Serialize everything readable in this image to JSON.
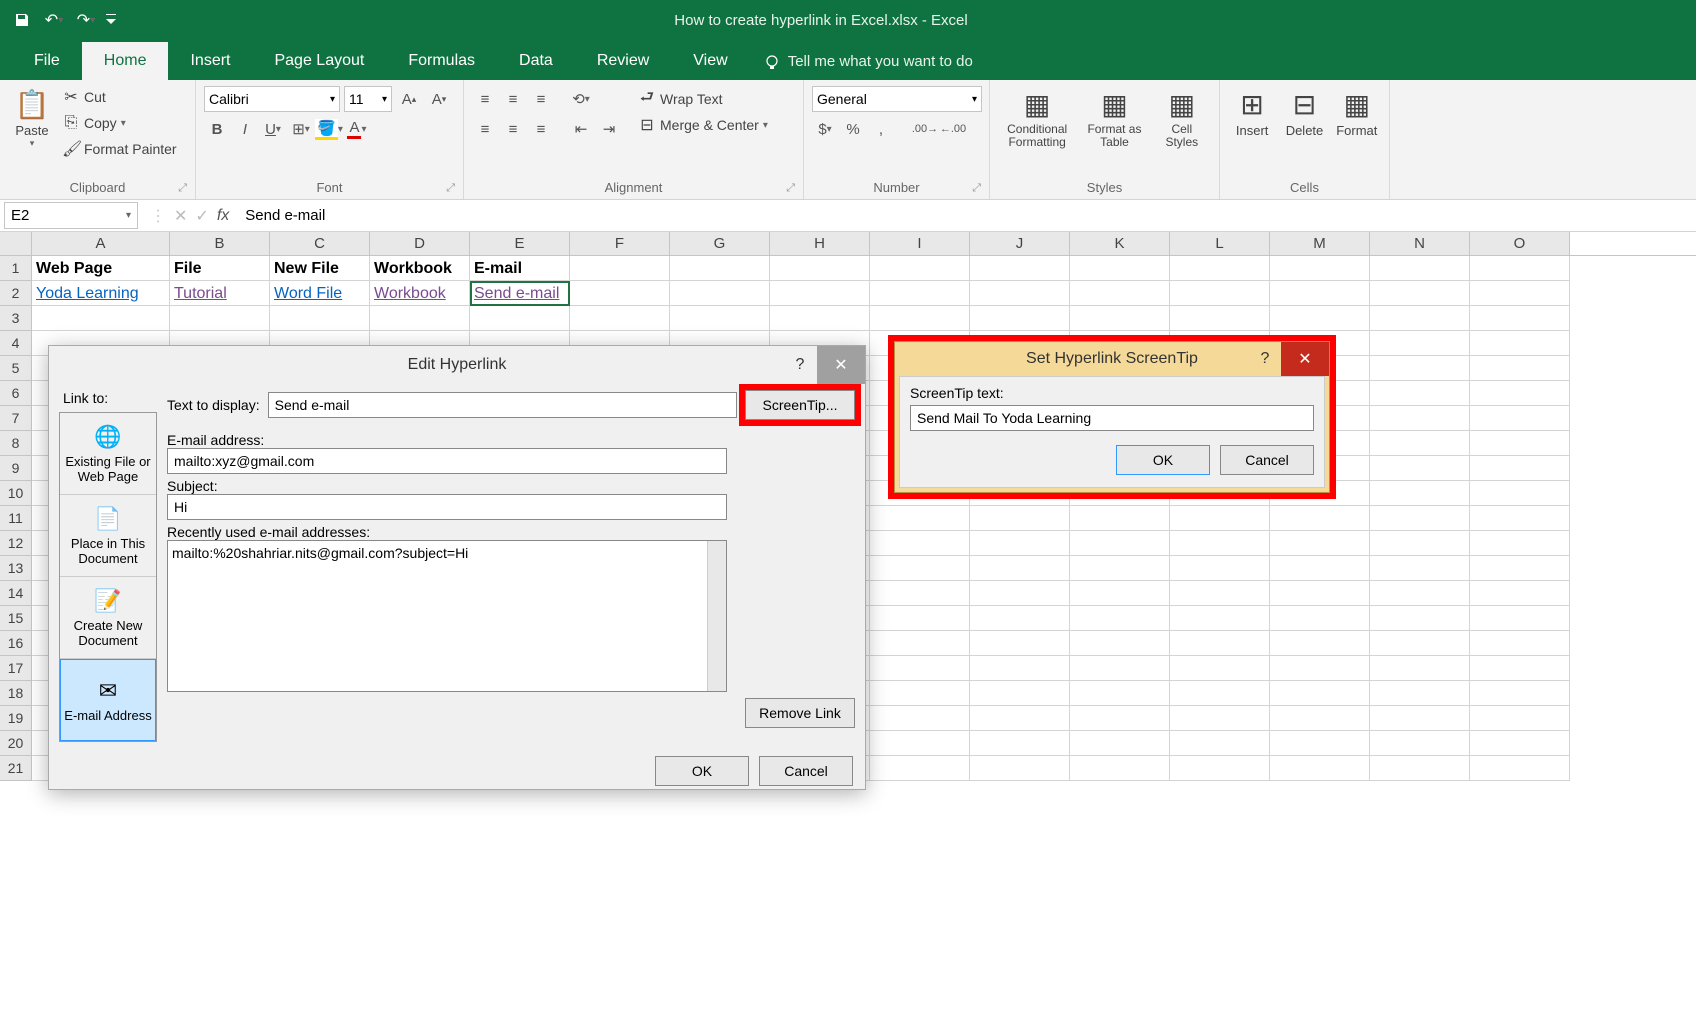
{
  "title": "How to create hyperlink in Excel.xlsx  -  Excel",
  "tabs": [
    "File",
    "Home",
    "Insert",
    "Page Layout",
    "Formulas",
    "Data",
    "Review",
    "View"
  ],
  "tellme": "Tell me what you want to do",
  "clipboard": {
    "paste": "Paste",
    "cut": "Cut",
    "copy": "Copy",
    "painter": "Format Painter",
    "label": "Clipboard"
  },
  "font": {
    "name": "Calibri",
    "size": "11",
    "label": "Font"
  },
  "alignment": {
    "wrap": "Wrap Text",
    "merge": "Merge & Center",
    "label": "Alignment"
  },
  "number": {
    "format": "General",
    "label": "Number"
  },
  "styles": {
    "cond": "Conditional Formatting",
    "tbl": "Format as Table",
    "cell": "Cell Styles",
    "label": "Styles"
  },
  "cells": {
    "insert": "Insert",
    "delete": "Delete",
    "format": "Format",
    "label": "Cells"
  },
  "namebox": "E2",
  "formula": "Send e-mail",
  "cols": [
    "A",
    "B",
    "C",
    "D",
    "E",
    "F",
    "G",
    "H",
    "I",
    "J",
    "K",
    "L",
    "M",
    "N",
    "O"
  ],
  "sheet": {
    "r1": {
      "a": "Web Page",
      "b": "File",
      "c": "New File",
      "d": "Workbook",
      "e": "E-mail"
    },
    "r2": {
      "a": "Yoda Learning",
      "b": "Tutorial",
      "c": "Word File",
      "d": "Workbook",
      "e": "Send e-mail"
    }
  },
  "dlg1": {
    "title": "Edit Hyperlink",
    "linkto": "Link to:",
    "texttodisplay_label": "Text to display:",
    "texttodisplay": "Send e-mail",
    "screentip": "ScreenTip...",
    "items": {
      "existing": "Existing File or Web Page",
      "place": "Place in This Document",
      "createnew": "Create New Document",
      "email": "E-mail Address"
    },
    "email_label": "E-mail address:",
    "email": "mailto:xyz@gmail.com",
    "subject_label": "Subject:",
    "subject": "Hi",
    "recent_label": "Recently used e-mail addresses:",
    "recent": "mailto:%20shahriar.nits@gmail.com?subject=Hi",
    "remove": "Remove Link",
    "ok": "OK",
    "cancel": "Cancel"
  },
  "dlg2": {
    "title": "Set Hyperlink ScreenTip",
    "label": "ScreenTip text:",
    "value": "Send Mail To Yoda Learning",
    "ok": "OK",
    "cancel": "Cancel"
  }
}
